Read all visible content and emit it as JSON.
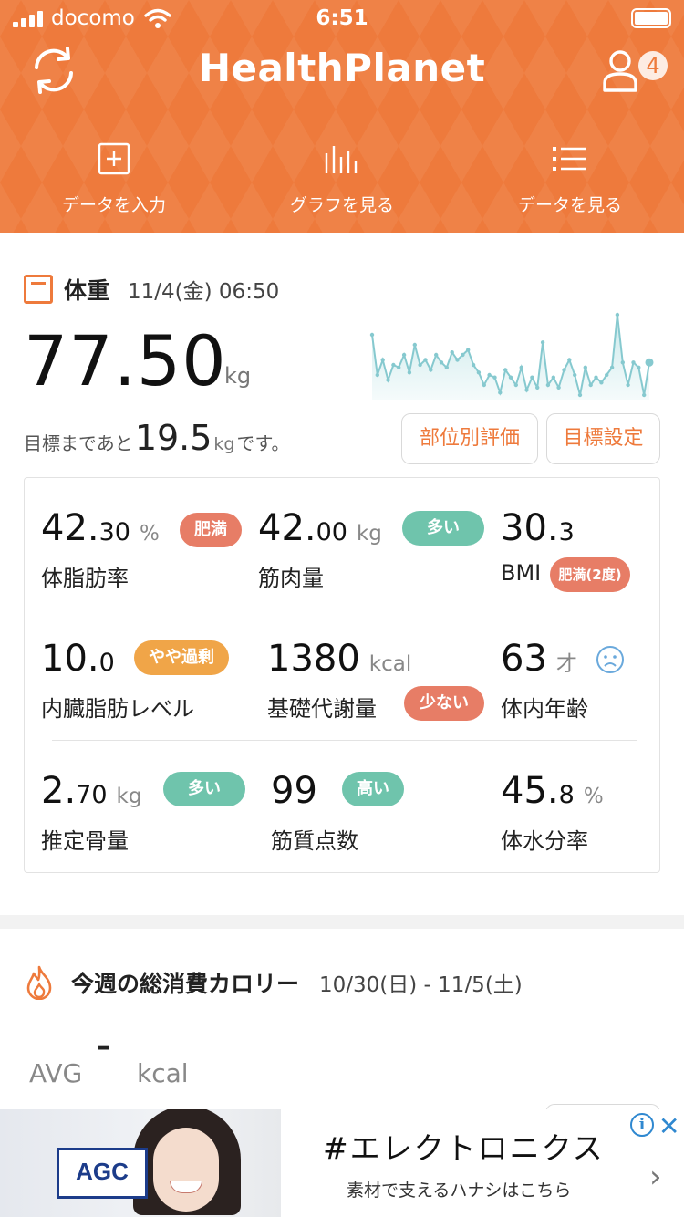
{
  "status_bar": {
    "carrier": "docomo",
    "time": "6:51"
  },
  "header": {
    "app_title": "HealthPlanet",
    "profile_badge": "4",
    "nav": [
      {
        "label": "データを入力",
        "icon": "plus-square-icon"
      },
      {
        "label": "グラフを見る",
        "icon": "bar-graph-icon"
      },
      {
        "label": "データを見る",
        "icon": "list-icon"
      }
    ],
    "colors": {
      "accent": "#ee7a3c"
    }
  },
  "weight": {
    "title": "体重",
    "date": "11/4(金) 06:50",
    "value": "77.50",
    "unit": "kg",
    "goal_prefix": "目標まであと",
    "goal_remaining": "19.5",
    "goal_unit": "kg",
    "goal_suffix": "です。",
    "btn_parts": "部位別評価",
    "btn_goal": "目標設定",
    "trend_values": [
      78.6,
      77.0,
      77.6,
      76.8,
      77.4,
      77.3,
      77.8,
      77.1,
      78.2,
      77.4,
      77.6,
      77.2,
      77.8,
      77.5,
      77.3,
      77.9,
      77.6,
      77.8,
      78.0,
      77.4,
      77.1,
      76.6,
      77.0,
      76.9,
      76.3,
      77.2,
      76.9,
      76.6,
      77.3,
      76.4,
      76.9,
      76.5,
      78.3,
      76.6,
      76.9,
      76.5,
      77.2,
      77.6,
      77.0,
      76.2,
      77.3,
      76.6,
      76.9,
      76.7,
      77.0,
      77.3,
      79.4,
      77.5,
      76.6,
      77.5,
      77.3,
      76.2,
      77.5
    ]
  },
  "metrics": [
    {
      "value": "42.",
      "decimals": "30",
      "unit": "%",
      "label": "体脂肪率",
      "badge": "肥満"
    },
    {
      "value": "42.",
      "decimals": "00",
      "unit": "kg",
      "label": "筋肉量",
      "badge": "多い"
    },
    {
      "value": "30.",
      "decimals": "3",
      "unit": "",
      "label": "BMI",
      "badge": "肥満(2度)"
    },
    {
      "value": "10.",
      "decimals": "0",
      "unit": "",
      "label": "内臓脂肪レベル",
      "badge": "やや過剰"
    },
    {
      "value": "1380",
      "decimals": "",
      "unit": "kcal",
      "label": "基礎代謝量",
      "badge": "少ない"
    },
    {
      "value": "63",
      "decimals": "",
      "unit": "才",
      "label": "体内年齢",
      "badge": ""
    },
    {
      "value": "2.",
      "decimals": "70",
      "unit": "kg",
      "label": "推定骨量",
      "badge": "多い"
    },
    {
      "value": "99",
      "decimals": "",
      "unit": "",
      "label": "筋質点数",
      "badge": "高い"
    },
    {
      "value": "45.",
      "decimals": "8",
      "unit": "%",
      "label": "体水分率",
      "badge": ""
    }
  ],
  "calories": {
    "title": "今週の総消費カロリー",
    "date_range": "10/30(日) - 11/5(土)",
    "avg_label": "AVG",
    "avg_value": "–",
    "avg_unit": "kcal"
  },
  "ad": {
    "sign_text": "AGC",
    "headline": "#エレクトロニクス",
    "subline": "素材で支えるハナシはこちら",
    "info": "i",
    "close": "✕",
    "chevron": "›"
  }
}
